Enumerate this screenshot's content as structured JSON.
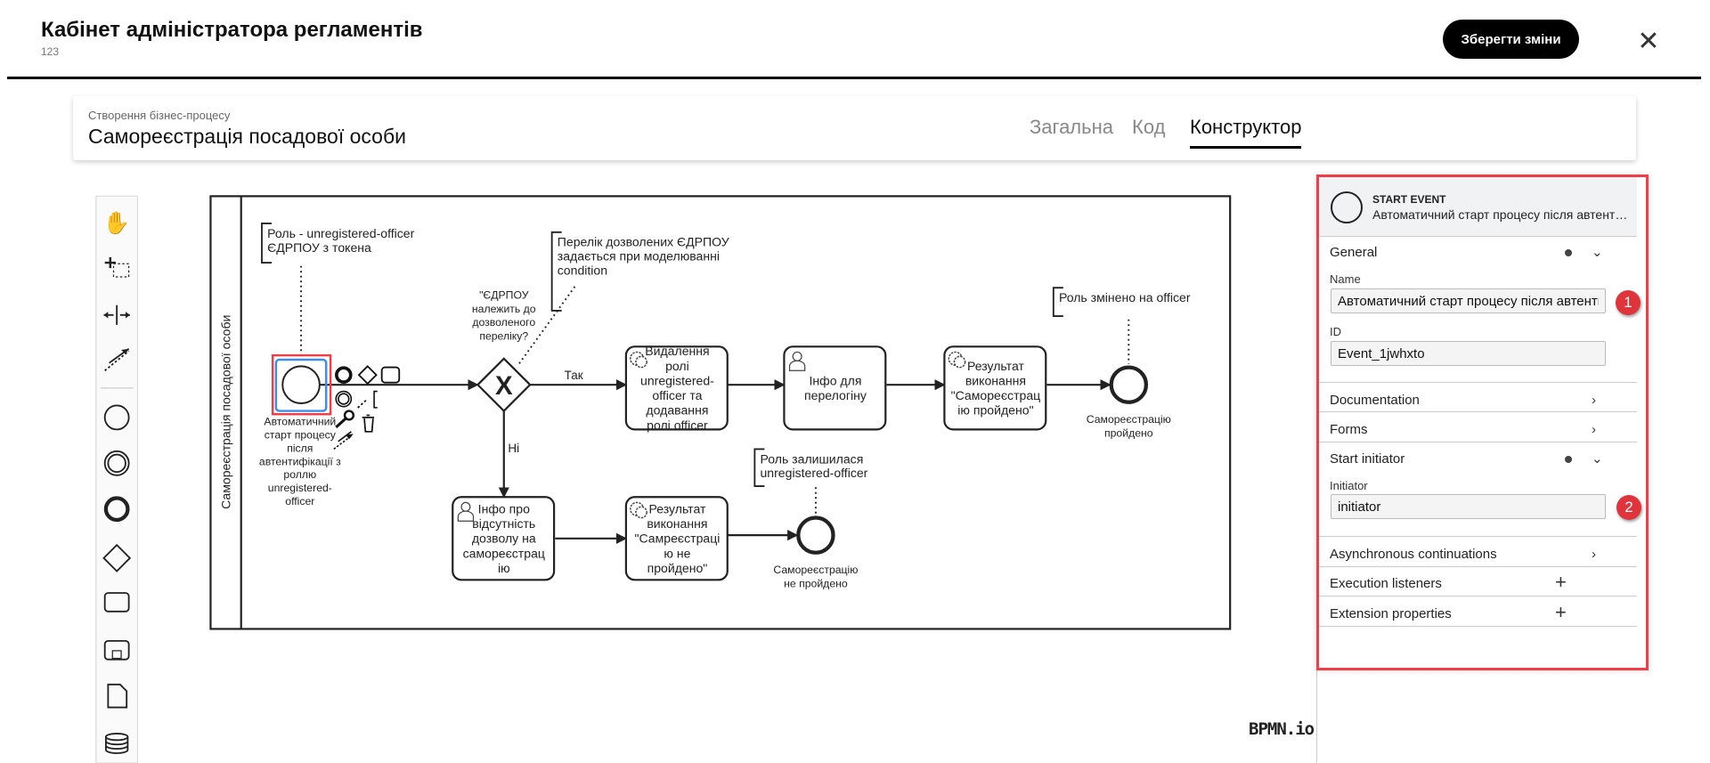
{
  "header": {
    "title": "Кабінет адміністратора регламентів",
    "subtitle": "123",
    "save_label": "Зберегти зміни",
    "close_icon": "close-icon"
  },
  "card": {
    "subtitle": "Створення бізнес-процесу",
    "title": "Самореєстрація посадової особи",
    "tabs": [
      {
        "label": "Загальна",
        "active": false
      },
      {
        "label": "Код",
        "active": false
      },
      {
        "label": "Конструктор",
        "active": true
      }
    ]
  },
  "toolbar": {
    "tools": [
      "hand-tool-icon",
      "lasso-tool-icon",
      "space-tool-icon",
      "global-connect-icon",
      "start-event-icon",
      "intermediate-event-icon",
      "end-event-icon",
      "gateway-icon",
      "task-icon",
      "subprocess-icon",
      "data-object-icon",
      "data-store-icon"
    ]
  },
  "diagram": {
    "lane_label": "Самореєстрація посадової особи",
    "start_event": {
      "label_lines": [
        "Автоматичний",
        "старт процесу",
        "після",
        "автентифікації з",
        "роллю",
        "unregistered-",
        "officer"
      ]
    },
    "gateway": {
      "label_lines": [
        "\"ЄДРПОУ",
        "належить до",
        "дозволеного",
        "переліку?"
      ]
    },
    "flows": {
      "yes": "Так",
      "no": "Ні"
    },
    "tasks": [
      {
        "type": "service",
        "lines": [
          "Видалення",
          "ролі",
          "unregistered-",
          "officer та",
          "додавання",
          "ролі officer"
        ]
      },
      {
        "type": "user",
        "lines": [
          "Інфо для",
          "перелогіну"
        ]
      },
      {
        "type": "service",
        "lines": [
          "Результат",
          "виконання",
          "\"Самореєстрац",
          "ію пройдено\""
        ]
      },
      {
        "type": "user",
        "lines": [
          "Інфо про",
          "відсутність",
          "дозволу на",
          "самореєстрац",
          "ію"
        ]
      },
      {
        "type": "service",
        "lines": [
          "Результат",
          "виконання",
          "\"Самреєстраці",
          "ю не",
          "пройдено\""
        ]
      }
    ],
    "end_events": [
      {
        "lines": [
          "Самореєстрацію",
          "пройдено"
        ]
      },
      {
        "lines": [
          "Самореєстрацію",
          "не пройдено"
        ]
      }
    ],
    "annotations": [
      {
        "lines": [
          "Роль - unregistered-officer",
          "ЄДРПОУ з токена"
        ]
      },
      {
        "lines": [
          "Перелік дозволених ЄДРПОУ",
          "задається при моделюванні",
          "condition"
        ]
      },
      {
        "lines": [
          "Роль змінено на officer"
        ]
      },
      {
        "lines": [
          "Роль залишилася",
          "unregistered-officer"
        ]
      }
    ],
    "watermark": "BPMN.io"
  },
  "properties": {
    "element_type": "START EVENT",
    "element_name": "Автоматичний старт процесу після автентифікації з роллю unregistered-officer",
    "groups": {
      "general": "General",
      "name_label": "Name",
      "name_value": "Автоматичний старт процесу після автентифікації з роллю unregistered-officer",
      "id_label": "ID",
      "id_value": "Event_1jwhxto",
      "documentation": "Documentation",
      "forms": "Forms",
      "start_initiator": "Start initiator",
      "initiator_label": "Initiator",
      "initiator_value": "initiator",
      "async": "Asynchronous continuations",
      "execution_listeners": "Execution listeners",
      "extension_properties": "Extension properties"
    },
    "badges": [
      "1",
      "2"
    ],
    "accent_color": "#ef3e47"
  }
}
